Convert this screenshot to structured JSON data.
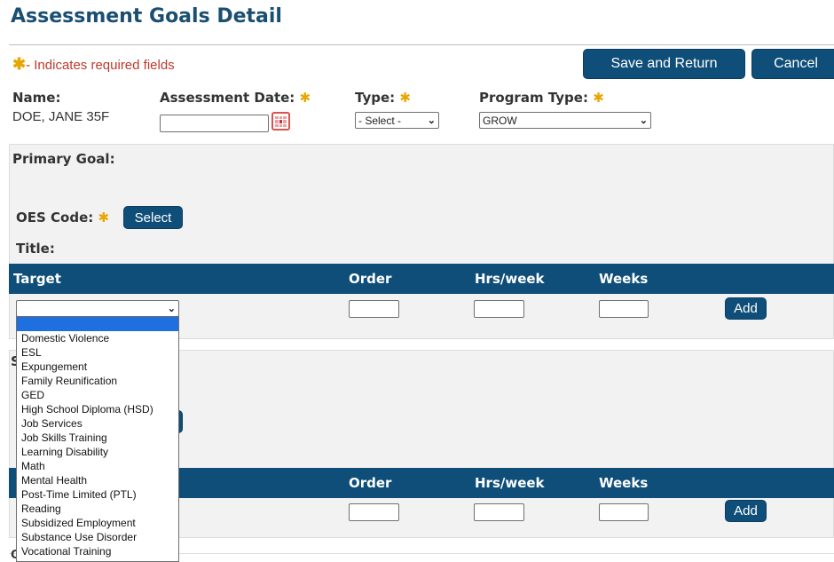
{
  "header": {
    "title": "Assessment Goals Detail",
    "required_note": "- Indicates required fields",
    "required_star": "✱",
    "save_label": "Save and Return",
    "cancel_label": "Cancel"
  },
  "fields": {
    "name_label": "Name:",
    "name_value": "DOE, JANE 35F",
    "assessment_date_label": "Assessment Date:",
    "assessment_date_value": "",
    "type_label": "Type:",
    "type_value": "- Select -",
    "program_type_label": "Program Type:",
    "program_type_value": "GROW"
  },
  "primary": {
    "title": "Primary Goal:",
    "oes_label": "OES Code:",
    "select_label": "Select",
    "title_label": "Title:",
    "grid": {
      "columns": [
        "Target",
        "Order",
        "Hrs/week",
        "Weeks"
      ],
      "add_label": "Add"
    }
  },
  "secondary": {
    "partial_letter_1": "S",
    "partial_letter_2": "C",
    "grid": {
      "columns": [
        "Order",
        "Hrs/week",
        "Weeks"
      ],
      "add_label": "Add"
    }
  },
  "target_dropdown": {
    "options": [
      "",
      "Domestic Violence",
      "ESL",
      "Expungement",
      "Family Reunification",
      "GED",
      "High School Diploma (HSD)",
      "Job Services",
      "Job Skills Training",
      "Learning Disability",
      "Math",
      "Mental Health",
      "Post-Time Limited (PTL)",
      "Reading",
      "Subsidized Employment",
      "Substance Use Disorder",
      "Vocational Training"
    ]
  }
}
